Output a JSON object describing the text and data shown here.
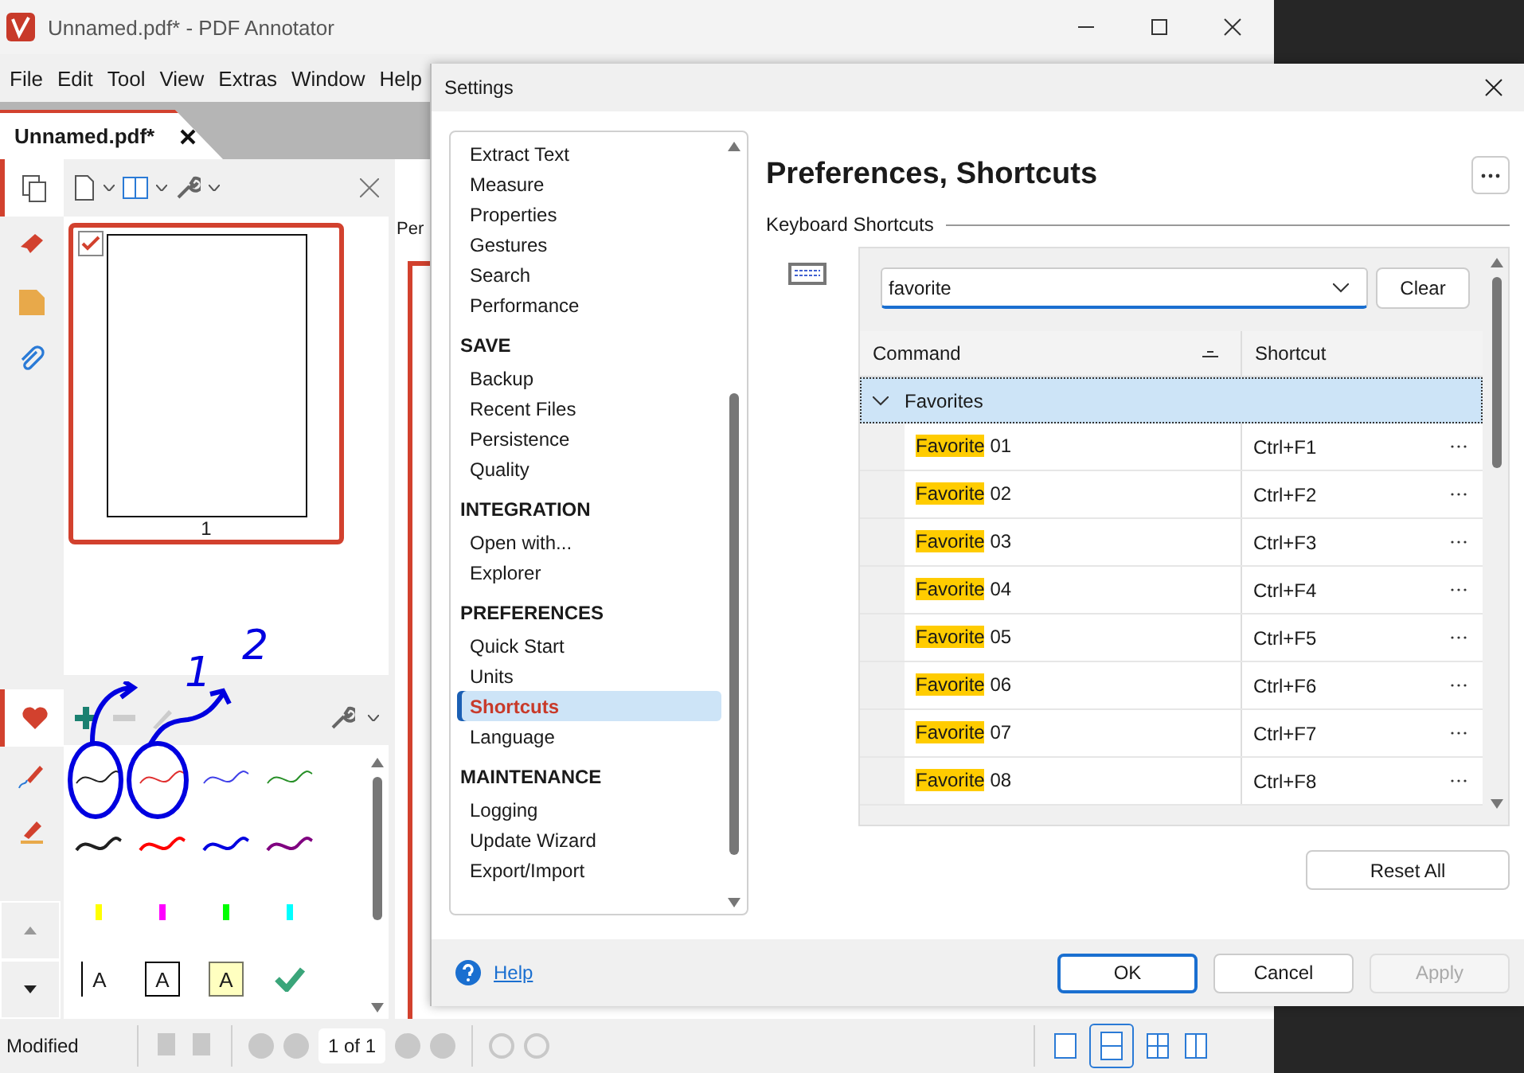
{
  "app_window": {
    "title": "Unnamed.pdf* - PDF Annotator",
    "menu": [
      "File",
      "Edit",
      "Tool",
      "View",
      "Extras",
      "Window",
      "Help"
    ],
    "doc_tab": {
      "label": "Unnamed.pdf*",
      "selected": true
    },
    "side_rail": [
      {
        "kind": "pages",
        "selected": true
      },
      {
        "kind": "bookmarks",
        "selected": false
      },
      {
        "kind": "notes",
        "selected": false
      },
      {
        "kind": "attachments",
        "selected": false
      }
    ],
    "thumbnail": {
      "page_label": "1",
      "checked": true
    },
    "doc_area_label": "Per",
    "tools_rail": [
      {
        "kind": "favorites",
        "selected": true
      },
      {
        "kind": "pen",
        "selected": false
      },
      {
        "kind": "highlighter",
        "selected": false
      }
    ],
    "presets": [
      [
        {
          "kind": "pen",
          "color": "#202020"
        },
        {
          "kind": "pen",
          "color": "#e03030"
        },
        {
          "kind": "pen",
          "color": "#4040e8"
        },
        {
          "kind": "pen",
          "color": "#289028"
        }
      ],
      [
        {
          "kind": "marker",
          "color": "#202020"
        },
        {
          "kind": "marker",
          "color": "#ff0000"
        },
        {
          "kind": "marker",
          "color": "#0000e0"
        },
        {
          "kind": "marker",
          "color": "#800080"
        }
      ],
      [
        {
          "kind": "highlighter",
          "color": "#ffff00"
        },
        {
          "kind": "highlighter",
          "color": "#ff00ff"
        },
        {
          "kind": "highlighter",
          "color": "#00ff00"
        },
        {
          "kind": "highlighter",
          "color": "#00ffff"
        }
      ],
      [
        {
          "kind": "text",
          "label": "A"
        },
        {
          "kind": "textbox",
          "label": "A"
        },
        {
          "kind": "note",
          "label": "A"
        },
        {
          "kind": "check",
          "color": "#3aa57a"
        }
      ]
    ],
    "annotations": [
      "1",
      "2"
    ],
    "status_bar": {
      "text": "Modified",
      "page_field": "1 of 1"
    }
  },
  "settings": {
    "title": "Settings",
    "nav": [
      {
        "items": [
          {
            "label": "Extract Text",
            "selected": false
          },
          {
            "label": "Measure",
            "selected": false
          },
          {
            "label": "Properties",
            "selected": false
          },
          {
            "label": "Gestures",
            "selected": false
          },
          {
            "label": "Search",
            "selected": false
          },
          {
            "label": "Performance",
            "selected": false
          }
        ]
      },
      {
        "heading": "SAVE",
        "items": [
          {
            "label": "Backup",
            "selected": false
          },
          {
            "label": "Recent Files",
            "selected": false
          },
          {
            "label": "Persistence",
            "selected": false
          },
          {
            "label": "Quality",
            "selected": false
          }
        ]
      },
      {
        "heading": "INTEGRATION",
        "items": [
          {
            "label": "Open with...",
            "selected": false
          },
          {
            "label": "Explorer",
            "selected": false
          }
        ]
      },
      {
        "heading": "PREFERENCES",
        "items": [
          {
            "label": "Quick Start",
            "selected": false
          },
          {
            "label": "Units",
            "selected": false
          },
          {
            "label": "Shortcuts",
            "selected": true
          },
          {
            "label": "Language",
            "selected": false
          }
        ]
      },
      {
        "heading": "MAINTENANCE",
        "items": [
          {
            "label": "Logging",
            "selected": false
          },
          {
            "label": "Update Wizard",
            "selected": false
          },
          {
            "label": "Export/Import",
            "selected": false
          }
        ]
      }
    ],
    "page_title": "Preferences, Shortcuts",
    "section_label": "Keyboard Shortcuts",
    "search": {
      "value": "favorite"
    },
    "clear_button": "Clear",
    "columns": [
      "Command",
      "Shortcut"
    ],
    "group": {
      "label": "Favorites",
      "expanded": true
    },
    "rows": [
      {
        "match": "Favorite",
        "rest": " 01",
        "shortcut": "Ctrl+F1"
      },
      {
        "match": "Favorite",
        "rest": " 02",
        "shortcut": "Ctrl+F2"
      },
      {
        "match": "Favorite",
        "rest": " 03",
        "shortcut": "Ctrl+F3"
      },
      {
        "match": "Favorite",
        "rest": " 04",
        "shortcut": "Ctrl+F4"
      },
      {
        "match": "Favorite",
        "rest": " 05",
        "shortcut": "Ctrl+F5"
      },
      {
        "match": "Favorite",
        "rest": " 06",
        "shortcut": "Ctrl+F6"
      },
      {
        "match": "Favorite",
        "rest": " 07",
        "shortcut": "Ctrl+F7"
      },
      {
        "match": "Favorite",
        "rest": " 08",
        "shortcut": "Ctrl+F8"
      }
    ],
    "reset_button": "Reset All",
    "help_link": "Help",
    "buttons": [
      {
        "label": "OK",
        "disabled": false
      },
      {
        "label": "Cancel",
        "disabled": false
      },
      {
        "label": "Apply",
        "disabled": true
      }
    ]
  }
}
